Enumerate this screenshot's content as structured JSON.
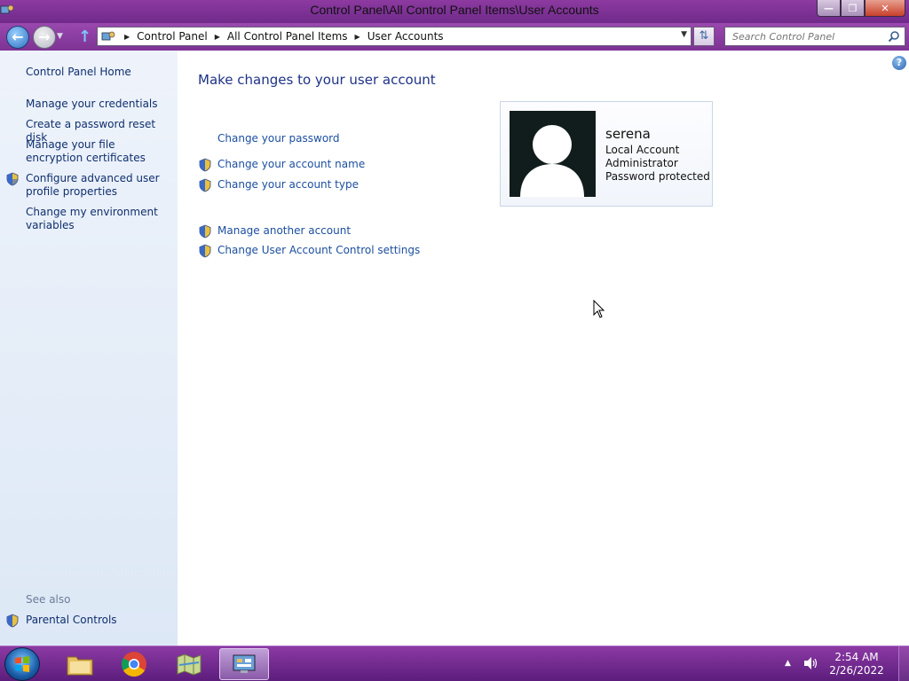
{
  "window": {
    "title": "Control Panel\\All Control Panel Items\\User Accounts"
  },
  "address": {
    "crumbs": [
      "Control Panel",
      "All Control Panel Items",
      "User Accounts"
    ]
  },
  "search": {
    "placeholder": "Search Control Panel"
  },
  "sidebar": {
    "home": "Control Panel Home",
    "items": [
      "Manage your credentials",
      "Create a password reset disk",
      "Manage your file encryption certificates",
      "Configure advanced user profile properties",
      "Change my environment variables"
    ],
    "see_also_label": "See also",
    "see_also_items": [
      "Parental Controls"
    ]
  },
  "main": {
    "heading": "Make changes to your user account",
    "tasks": [
      "Change your password",
      "Change your account name",
      "Change your account type",
      "Manage another account",
      "Change User Account Control settings"
    ]
  },
  "user": {
    "name": "serena",
    "lines": [
      "Local Account",
      "Administrator",
      "Password protected"
    ]
  },
  "taskbar": {
    "time": "2:54 AM",
    "date": "2/26/2022"
  },
  "colors": {
    "title_bar": "#7d3394",
    "link": "#1c4fa0",
    "heading": "#1e3287",
    "sidebar_bg": "#e6eef9"
  }
}
